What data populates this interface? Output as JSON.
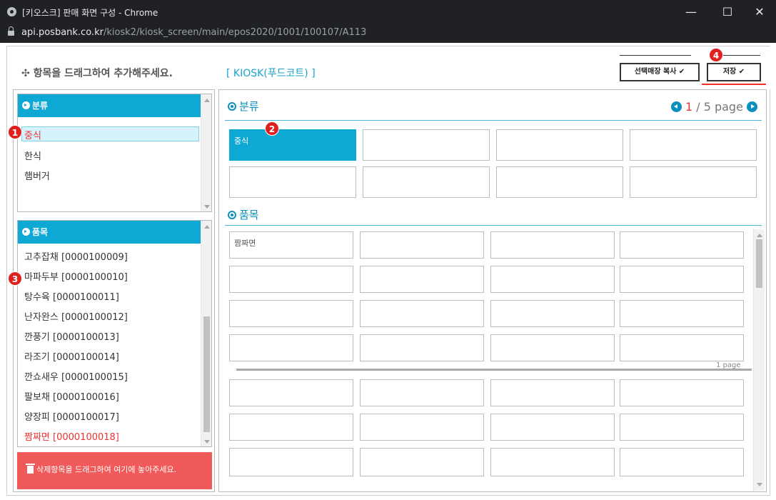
{
  "window": {
    "title": "[키오스크] 판매 화면 구성 - Chrome",
    "host": "api.posbank.co.kr",
    "path": "/kiosk2/kiosk_screen/main/epos2020/1001/100107/A113",
    "minimize": "—",
    "maximize": "☐",
    "close": "✕"
  },
  "header": {
    "drag_hint": "✣ 항목을 드래그하여 추가해주세요.",
    "kiosk_label": "[ KIOSK(푸드코트) ]",
    "copy_button": "선택매장 복사 ✔",
    "save_button": "저장 ✔"
  },
  "category_box": {
    "title": "분류",
    "items": [
      "중식",
      "한식",
      "햄버거"
    ]
  },
  "item_box": {
    "title": "품목",
    "items": [
      "고추잡채 [0000100009]",
      "마파두부 [0000100010]",
      "탕수육 [0000100011]",
      "난자완스 [0000100012]",
      "깐풍기 [0000100013]",
      "라조기 [0000100014]",
      "깐쇼새우 [0000100015]",
      "팔보채 [0000100016]",
      "양장피 [0000100017]",
      "짬짜면 [0000100018]"
    ]
  },
  "trash": {
    "label": "삭제항목을 드래그하여 여기에 놓아주세요."
  },
  "category_grid": {
    "title": "분류",
    "pager_current": "1",
    "pager_rest": " / 5 page ",
    "cells": [
      "중식",
      "",
      "",
      "",
      "",
      "",
      "",
      ""
    ]
  },
  "item_grid": {
    "title": "품목",
    "first_cell": "짬짜면",
    "page_tag": "1 page"
  },
  "badges": [
    "1",
    "2",
    "3",
    "4"
  ],
  "colors": {
    "accent": "#0ea8d4",
    "highlight": "#e32222",
    "trash": "#f15a5a"
  }
}
